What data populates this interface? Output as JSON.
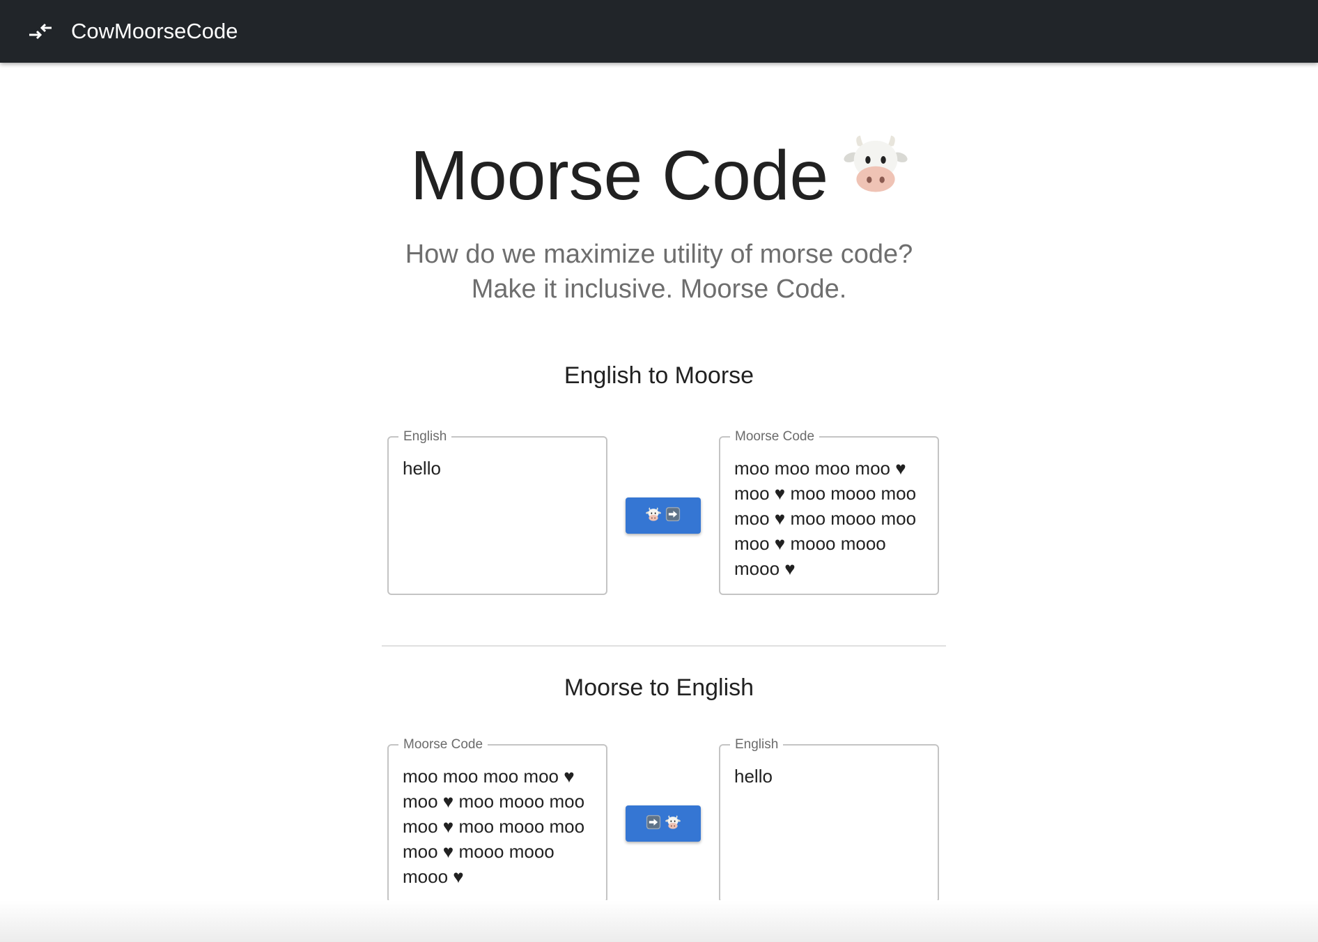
{
  "app_bar": {
    "icon": "swap-arrows-icon",
    "title": "CowMoorseCode"
  },
  "hero": {
    "title": "Moorse Code",
    "title_icon": "cow-face-icon",
    "subtitle_line1": "How do we maximize utility of morse code?",
    "subtitle_line2": "Make it inclusive. Moorse Code."
  },
  "english_to_moorse": {
    "heading": "English to Moorse",
    "input": {
      "label": "English",
      "value": "hello"
    },
    "button": {
      "icons": [
        "cow-face-icon",
        "right-arrow-icon"
      ]
    },
    "output": {
      "label": "Moorse Code",
      "value": "moo moo moo moo ♥ moo ♥ moo mooo moo moo ♥ moo mooo moo moo ♥ mooo mooo mooo ♥"
    }
  },
  "moorse_to_english": {
    "heading": "Moorse to English",
    "input": {
      "label": "Moorse Code",
      "value": "moo moo moo moo ♥ moo ♥ moo mooo moo moo ♥ moo mooo moo moo ♥ mooo mooo mooo ♥"
    },
    "button": {
      "icons": [
        "right-arrow-icon",
        "cow-face-icon"
      ]
    },
    "output": {
      "label": "English",
      "value": "hello"
    }
  },
  "colors": {
    "app_bar": "#212529",
    "button": "#3576d3",
    "subtitle": "#6e6e6e"
  }
}
